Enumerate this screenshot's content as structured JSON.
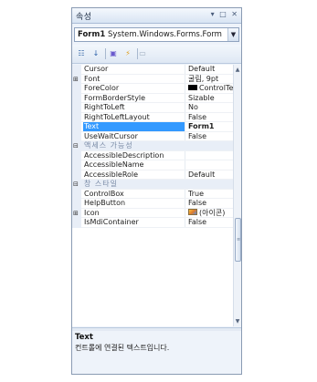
{
  "window": {
    "title": "속성",
    "controls": {
      "dropdown": "▾",
      "pin": "□",
      "close": "✕"
    }
  },
  "object_selector": {
    "name": "Form1",
    "type": "System.Windows.Forms.Form"
  },
  "toolbar": {
    "buttons": [
      {
        "name": "categorized-view-button",
        "icon": "categorized-icon",
        "glyph": "☷",
        "color": "#3a6aa8"
      },
      {
        "name": "alphabetical-view-button",
        "icon": "sort-az-icon",
        "glyph": "↓",
        "color": "#2a5ea8"
      },
      {
        "name": "properties-view-button",
        "icon": "properties-icon",
        "glyph": "▣",
        "color": "#6a5acd"
      },
      {
        "name": "events-view-button",
        "icon": "events-lightning-icon",
        "glyph": "⚡",
        "color": "#e0a020"
      },
      {
        "name": "property-pages-button",
        "icon": "property-pages-icon",
        "glyph": "▭",
        "color": "#9aa8bb"
      }
    ]
  },
  "grid": {
    "rows": [
      {
        "kind": "prop",
        "name": "Cursor",
        "value": "Default"
      },
      {
        "kind": "prop",
        "name": "Font",
        "value": "굴림, 9pt",
        "expander": "⊞"
      },
      {
        "kind": "prop",
        "name": "ForeColor",
        "value": "ControlText",
        "swatch": "#000000"
      },
      {
        "kind": "prop",
        "name": "FormBorderStyle",
        "value": "Sizable"
      },
      {
        "kind": "prop",
        "name": "RightToLeft",
        "value": "No"
      },
      {
        "kind": "prop",
        "name": "RightToLeftLayout",
        "value": "False"
      },
      {
        "kind": "prop",
        "name": "Text",
        "value": "Form1",
        "selected": true
      },
      {
        "kind": "prop",
        "name": "UseWaitCursor",
        "value": "False"
      },
      {
        "kind": "category",
        "name": "액세스 가능성",
        "expander": "⊟"
      },
      {
        "kind": "prop",
        "name": "AccessibleDescription",
        "value": ""
      },
      {
        "kind": "prop",
        "name": "AccessibleName",
        "value": ""
      },
      {
        "kind": "prop",
        "name": "AccessibleRole",
        "value": "Default"
      },
      {
        "kind": "category",
        "name": "창 스타일",
        "expander": "⊟"
      },
      {
        "kind": "prop",
        "name": "ControlBox",
        "value": "True"
      },
      {
        "kind": "prop",
        "name": "HelpButton",
        "value": "False"
      },
      {
        "kind": "prop",
        "name": "Icon",
        "value": "(아이콘)",
        "expander": "⊞",
        "icon_swatch": true
      },
      {
        "kind": "prop",
        "name": "IsMdiContainer",
        "value": "False"
      }
    ]
  },
  "scrollbar": {
    "up": "▲",
    "down": "▼",
    "grip": "≡"
  },
  "description": {
    "title": "Text",
    "text": "컨트롤에 연결된 텍스트입니다."
  }
}
